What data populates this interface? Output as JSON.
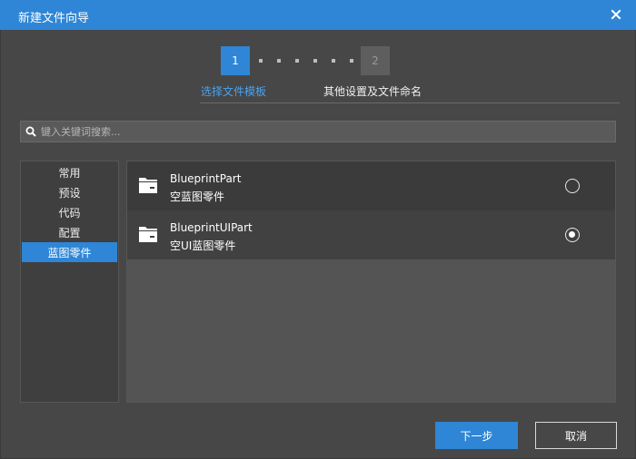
{
  "window": {
    "title": "新建文件向导",
    "icons": {
      "close": "close-icon"
    }
  },
  "steps": {
    "items": [
      {
        "number": "1",
        "label": "选择文件模板",
        "active": true
      },
      {
        "number": "2",
        "label": "其他设置及文件命名",
        "active": false
      }
    ]
  },
  "search": {
    "placeholder": "键入关键词搜索...",
    "value": "",
    "icon": "search-icon"
  },
  "sidebar": {
    "items": [
      {
        "label": "常用"
      },
      {
        "label": "预设"
      },
      {
        "label": "代码"
      },
      {
        "label": "配置"
      },
      {
        "label": "蓝图零件",
        "selected": true
      }
    ]
  },
  "templates": [
    {
      "name": "BlueprintPart",
      "description": "空蓝图零件",
      "selected": false,
      "icon": "folder-icon"
    },
    {
      "name": "BlueprintUIPart",
      "description": "空UI蓝图零件",
      "selected": true,
      "icon": "folder-icon"
    }
  ],
  "buttons": {
    "next": "下一步",
    "cancel": "取消"
  },
  "colors": {
    "accent": "#2f86d6",
    "accent_text": "#4aa2f0",
    "background": "#474747",
    "panel": "#3f3f3f"
  }
}
